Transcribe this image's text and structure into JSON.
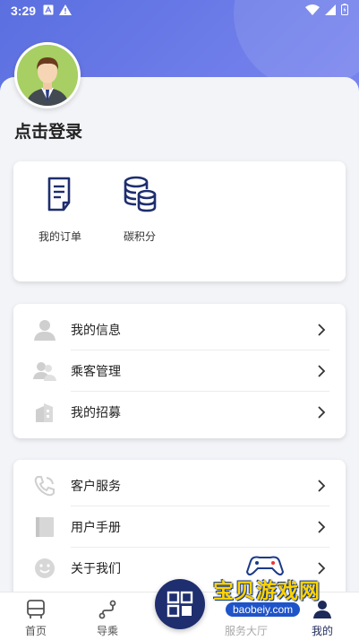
{
  "status_bar": {
    "time": "3:29"
  },
  "profile": {
    "login_prompt": "点击登录"
  },
  "quick_actions": [
    {
      "label": "我的订单",
      "icon": "order-document-icon"
    },
    {
      "label": "碳积分",
      "icon": "coin-stack-icon"
    }
  ],
  "menu_group_1": [
    {
      "label": "我的信息",
      "icon": "user-icon"
    },
    {
      "label": "乘客管理",
      "icon": "passengers-icon"
    },
    {
      "label": "我的招募",
      "icon": "building-icon"
    }
  ],
  "menu_group_2": [
    {
      "label": "客户服务",
      "icon": "phone-icon"
    },
    {
      "label": "用户手册",
      "icon": "manual-icon"
    },
    {
      "label": "关于我们",
      "icon": "smile-icon"
    }
  ],
  "bottom_nav": [
    {
      "label": "首页",
      "icon": "bus-icon"
    },
    {
      "label": "导乘",
      "icon": "route-icon"
    },
    {
      "label": "服务大厅",
      "icon": "grid-icon"
    },
    {
      "label": "我的",
      "icon": "person-icon",
      "active": true
    }
  ],
  "watermark": {
    "title": "宝贝游戏网",
    "url": "baobeiy.com"
  },
  "colors": {
    "accent": "#1e2e6e",
    "header": "#6a78e8"
  }
}
